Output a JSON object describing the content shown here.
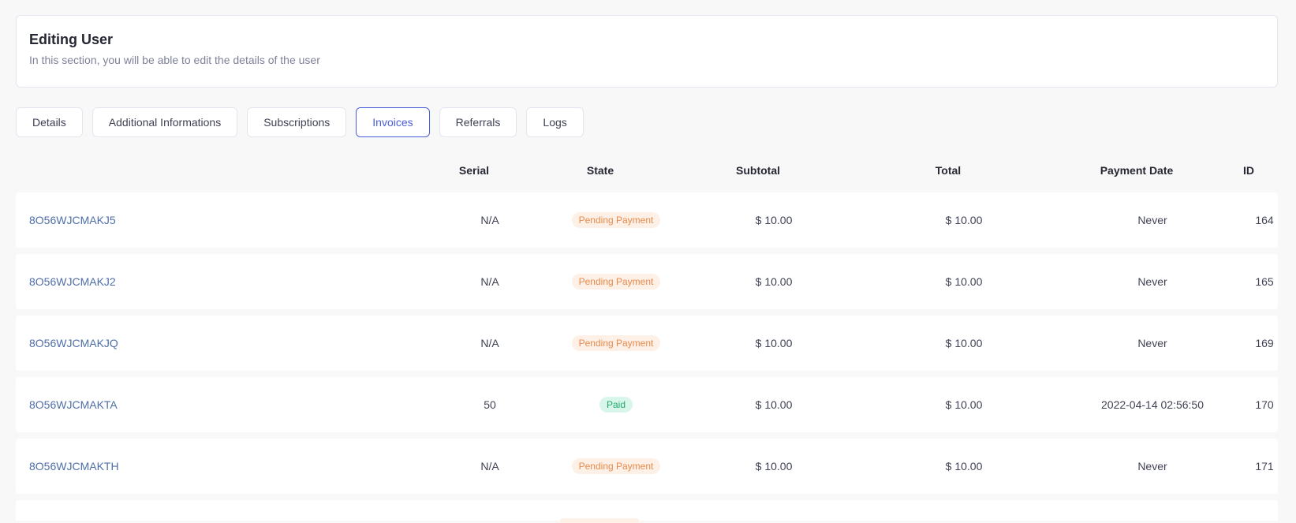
{
  "header": {
    "title": "Editing User",
    "subtitle": "In this section, you will be able to edit the details of the user"
  },
  "tabs": [
    {
      "label": "Details",
      "active": false
    },
    {
      "label": "Additional Informations",
      "active": false
    },
    {
      "label": "Subscriptions",
      "active": false
    },
    {
      "label": "Invoices",
      "active": true
    },
    {
      "label": "Referrals",
      "active": false
    },
    {
      "label": "Logs",
      "active": false
    }
  ],
  "table": {
    "columns": {
      "serial": "Serial",
      "state": "State",
      "subtotal": "Subtotal",
      "total": "Total",
      "payment_date": "Payment Date",
      "id": "ID"
    },
    "rows": [
      {
        "reference": "8O56WJCMAKJ5",
        "serial": "N/A",
        "state": "Pending Payment",
        "state_type": "pending",
        "subtotal": "$ 10.00",
        "total": "$ 10.00",
        "payment_date": "Never",
        "id": "164"
      },
      {
        "reference": "8O56WJCMAKJ2",
        "serial": "N/A",
        "state": "Pending Payment",
        "state_type": "pending",
        "subtotal": "$ 10.00",
        "total": "$ 10.00",
        "payment_date": "Never",
        "id": "165"
      },
      {
        "reference": "8O56WJCMAKJQ",
        "serial": "N/A",
        "state": "Pending Payment",
        "state_type": "pending",
        "subtotal": "$ 10.00",
        "total": "$ 10.00",
        "payment_date": "Never",
        "id": "169"
      },
      {
        "reference": "8O56WJCMAKTA",
        "serial": "50",
        "state": "Paid",
        "state_type": "paid",
        "subtotal": "$ 10.00",
        "total": "$ 10.00",
        "payment_date": "2022-04-14 02:56:50",
        "id": "170"
      },
      {
        "reference": "8O56WJCMAKTH",
        "serial": "N/A",
        "state": "Pending Payment",
        "state_type": "pending",
        "subtotal": "$ 10.00",
        "total": "$ 10.00",
        "payment_date": "Never",
        "id": "171"
      }
    ]
  },
  "colors": {
    "accent": "#4a60d9",
    "link": "#4f6ea8",
    "pending_bg": "#fdf0e6",
    "pending_text": "#e88a4c",
    "paid_bg": "#d9f6ea",
    "paid_text": "#23a86d"
  }
}
